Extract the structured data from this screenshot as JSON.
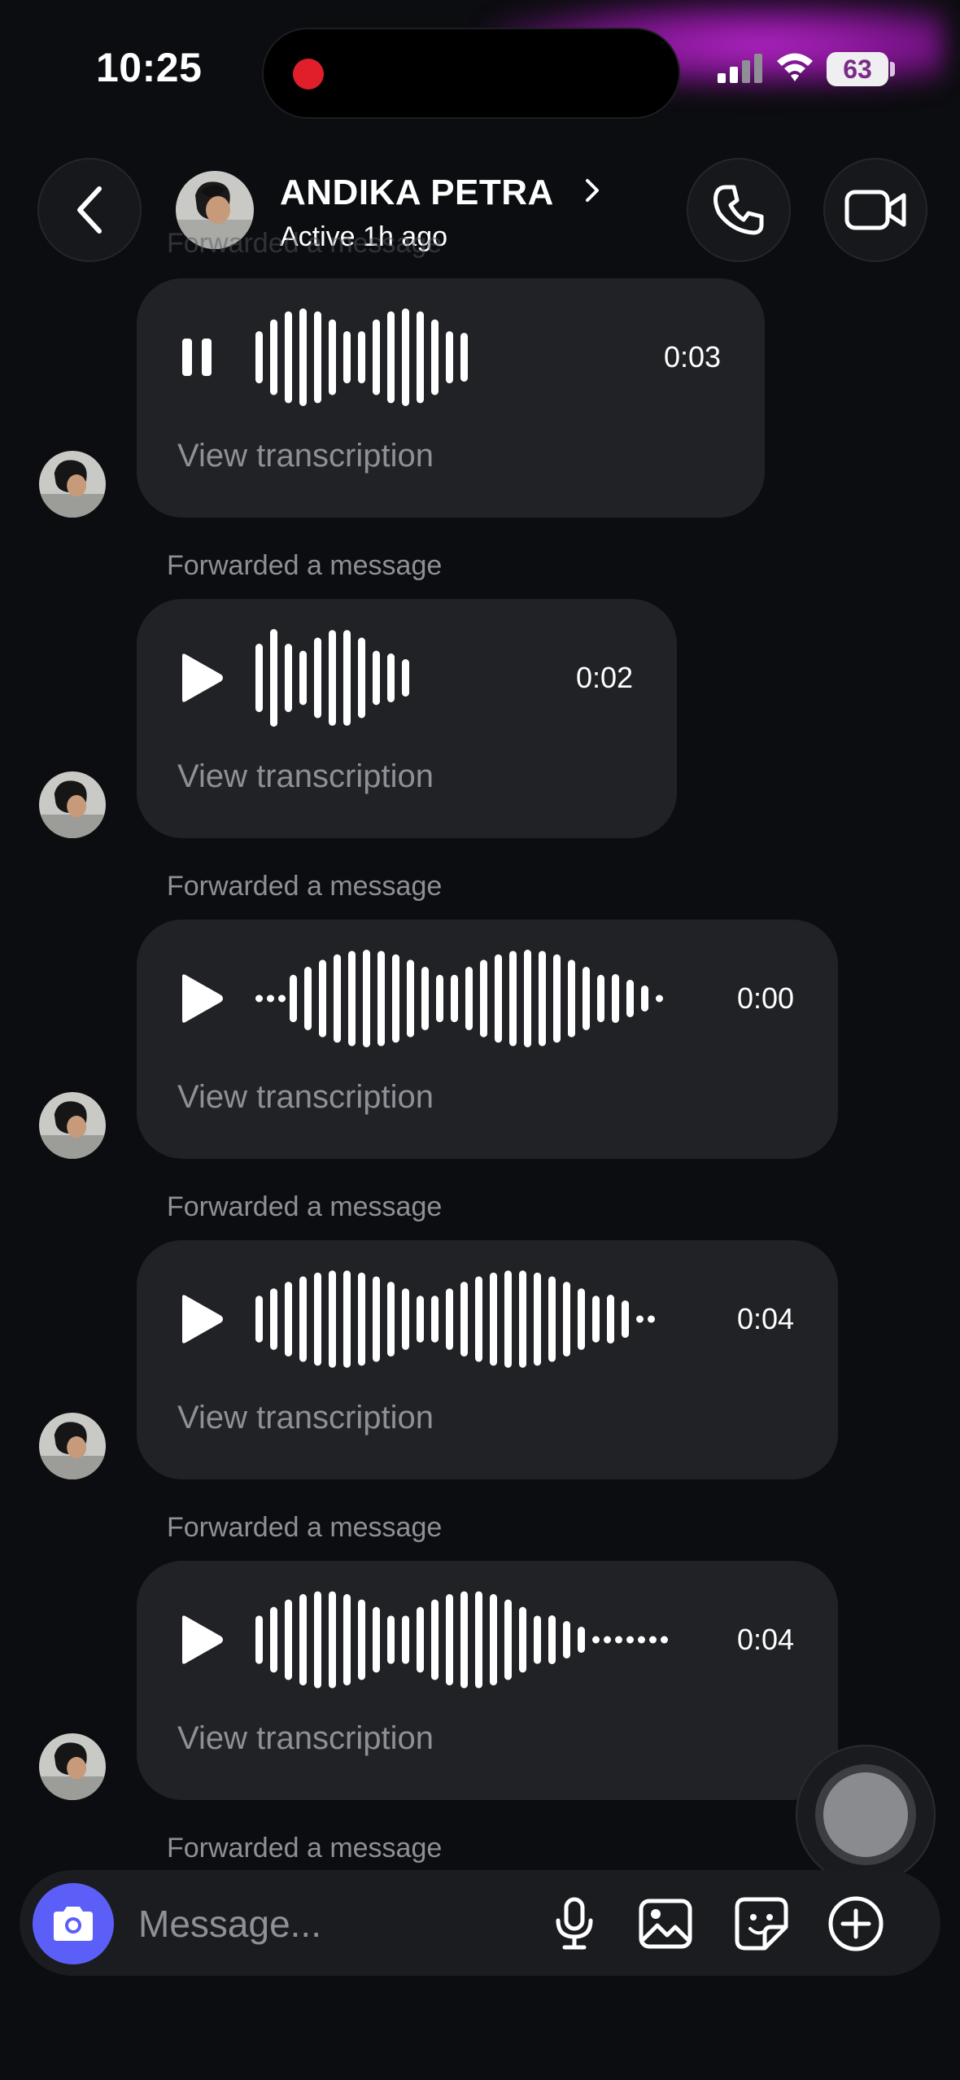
{
  "status_bar": {
    "time": "10:25",
    "battery": "63"
  },
  "header": {
    "contact_name": "ANDIKA PETRA",
    "contact_status": "Active 1h ago",
    "back_icon": "chevron-left-icon",
    "call_icon": "phone-icon",
    "video_icon": "video-camera-icon"
  },
  "messages": [
    {
      "state": "playing",
      "duration": "0:03",
      "transcription_label": "View transcription"
    },
    {
      "state": "paused",
      "forwarded_label": "Forwarded a message",
      "duration": "0:02",
      "transcription_label": "View transcription"
    },
    {
      "state": "paused",
      "forwarded_label": "Forwarded a message",
      "duration": "0:00",
      "transcription_label": "View transcription"
    },
    {
      "state": "paused",
      "forwarded_label": "Forwarded a message",
      "duration": "0:04",
      "transcription_label": "View transcription"
    },
    {
      "state": "paused",
      "forwarded_label": "Forwarded a message",
      "duration": "0:04",
      "transcription_label": "View transcription"
    }
  ],
  "bottom_label": "Forwarded a message",
  "composer": {
    "placeholder": "Message...",
    "icons": [
      "camera-icon",
      "microphone-icon",
      "gallery-icon",
      "sticker-icon",
      "plus-circle-icon"
    ]
  },
  "colors": {
    "background": "#0c0d10",
    "bubble": "#212226",
    "accent": "#5b5ff7",
    "muted_text": "#8d9096"
  }
}
